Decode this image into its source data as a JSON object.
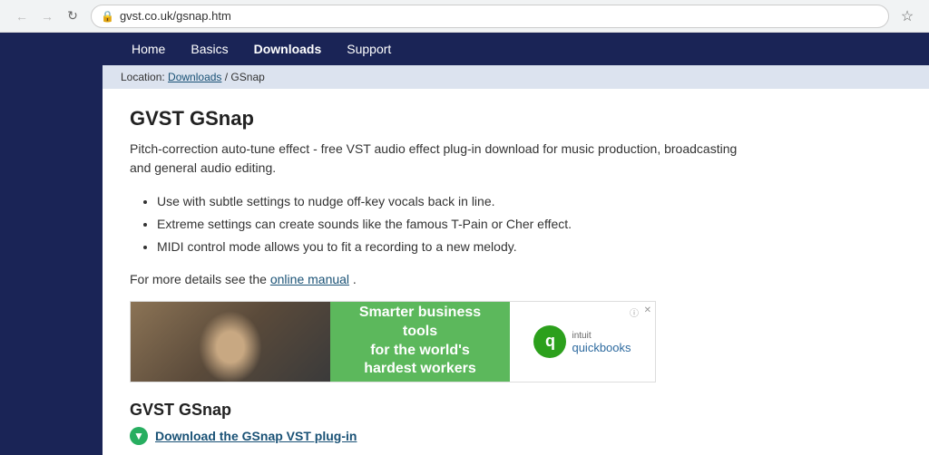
{
  "browser": {
    "url": "gvst.co.uk/gsnap.htm",
    "back_disabled": true,
    "forward_disabled": true
  },
  "nav": {
    "items": [
      {
        "label": "Home",
        "active": false
      },
      {
        "label": "Basics",
        "active": false
      },
      {
        "label": "Downloads",
        "active": true
      },
      {
        "label": "Support",
        "active": false
      }
    ]
  },
  "breadcrumb": {
    "prefix": "Location:",
    "link_label": "Downloads",
    "separator": "/ GSnap"
  },
  "content": {
    "page_title": "GVST GSnap",
    "description": "Pitch-correction auto-tune effect - free VST audio effect plug-in download for music production, broadcasting and general audio editing.",
    "bullets": [
      "Use with subtle settings to nudge off-key vocals back in line.",
      "Extreme settings can create sounds like the famous T-Pain or Cher effect.",
      "MIDI control mode allows you to fit a recording to a new melody."
    ],
    "manual_prefix": "For more details see the",
    "manual_link": "online manual",
    "manual_suffix": "."
  },
  "ad": {
    "middle_text": "Smarter business tools\nfor the world's hardest workers",
    "brand_label": "intuit",
    "product_label": "quickbooks",
    "info_label": "ⓘ",
    "close_label": "✕"
  },
  "download_section": {
    "title": "GVST GSnap",
    "link_label": "Download the GSnap VST plug-in",
    "icon_char": "▼"
  }
}
